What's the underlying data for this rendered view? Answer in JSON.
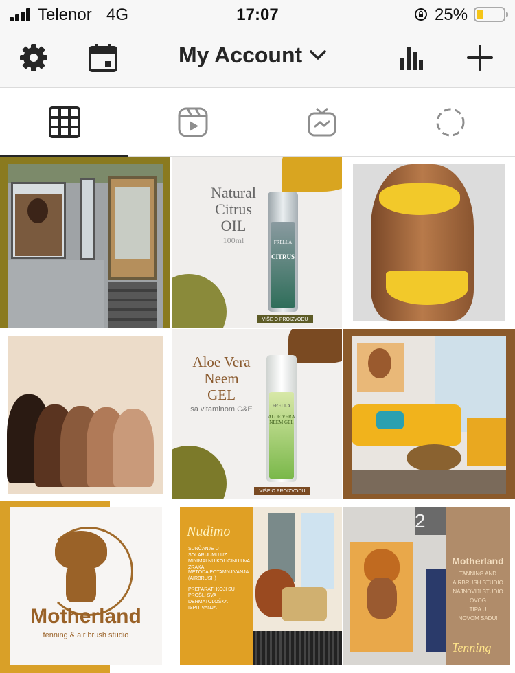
{
  "status_bar": {
    "carrier": "Telenor",
    "network": "4G",
    "time": "17:07",
    "battery": "25%",
    "battery_level": 0.25
  },
  "header": {
    "account_title": "My Account",
    "icons": [
      "gear-icon",
      "calendar-icon",
      "chevron-down-icon",
      "insights-icon",
      "plus-icon"
    ]
  },
  "tabs": [
    {
      "name": "grid",
      "icon": "grid-icon",
      "active": true
    },
    {
      "name": "reels",
      "icon": "reels-icon",
      "active": false
    },
    {
      "name": "igtv",
      "icon": "igtv-icon",
      "active": false
    },
    {
      "name": "stories",
      "icon": "dashed-circle-icon",
      "active": false
    }
  ],
  "posts": {
    "citrus": {
      "title_l1": "Natural",
      "title_l2": "Citrus",
      "title_l3": "OIL",
      "size": "100ml",
      "brand": "FRELLA",
      "bottle_text": "CITRUS",
      "cta": "VIŠE O PROIZVODU"
    },
    "aloe": {
      "title_l1": "Aloe Vera",
      "title_l2": "Neem",
      "title_l3": "GEL",
      "subtitle": "sa vitaminom C&E",
      "brand": "FRELLA",
      "bottle_text": "ALOE VERA NEEM GEL",
      "cta": "VIŠE O PROIZVODU"
    },
    "motherland": {
      "brand": "Motherland",
      "tagline": "tenning & air brush studio"
    },
    "nudimo": {
      "heading": "Nudimo",
      "items": [
        "SUNČANJE U SOLARIJUMU UZ MINIMALNU KOLIČINU UVA ZRAKA",
        "METODA POTAMNJIVANJA (AIRBRUSH)",
        "PREPARATI KOJI SU PROŠLI SVA DERMATOLOŠKA ISPITIVANJA"
      ]
    },
    "studio": {
      "brand": "Motherland",
      "line1": "TANNING AND",
      "line2": "AIRBRUSH STUDIO",
      "line3": "NAJNOVIJI STUDIO",
      "line4": "OVOG",
      "line5": "TIPA U",
      "line6": "NOVOM SADU!",
      "script": "Tenning",
      "room_number": "2"
    }
  },
  "colors": {
    "bar_bg": "#f7f7f7",
    "olive": "#8a7a1f",
    "mustard": "#e0a020",
    "brown": "#8b5a2b",
    "text": "#262626"
  }
}
